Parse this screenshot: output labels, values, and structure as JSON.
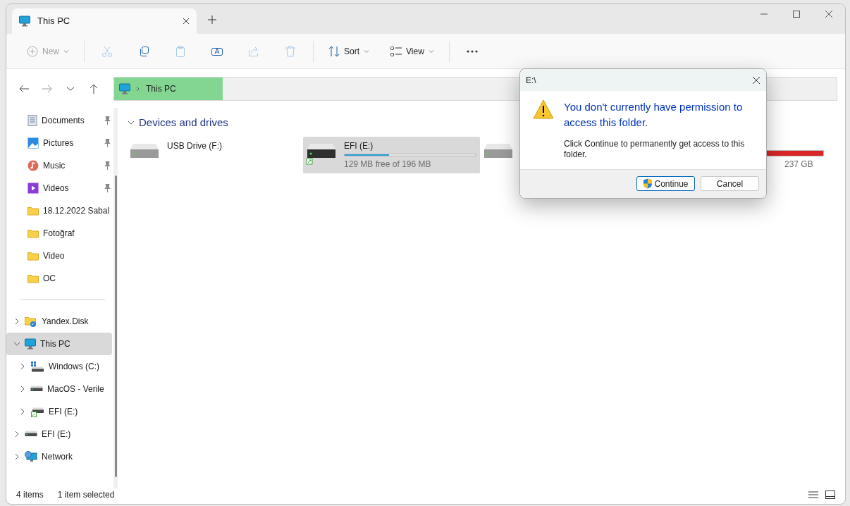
{
  "tabs": [
    {
      "title": "This PC",
      "selected": true
    }
  ],
  "toolbar": [
    {
      "kind": "new",
      "label": "New",
      "disabled": true
    },
    {
      "kind": "cut",
      "disabled": true
    },
    {
      "kind": "copy",
      "disabled": false
    },
    {
      "kind": "paste",
      "disabled": true
    },
    {
      "kind": "rename",
      "disabled": false
    },
    {
      "kind": "share",
      "disabled": true
    },
    {
      "kind": "delete",
      "disabled": true
    },
    {
      "kind": "sort",
      "label": "Sort",
      "disabled": false
    },
    {
      "kind": "view",
      "label": "View",
      "disabled": false
    },
    {
      "kind": "more",
      "disabled": false
    }
  ],
  "address": {
    "path": "This PC"
  },
  "sidebar": {
    "quick_access": [
      {
        "kind": "documents",
        "label": "Documents",
        "pinned": true
      },
      {
        "kind": "pictures",
        "label": "Pictures",
        "pinned": true
      },
      {
        "kind": "music",
        "label": "Music",
        "pinned": true
      },
      {
        "kind": "videos",
        "label": "Videos",
        "pinned": true
      },
      {
        "kind": "folder",
        "label": "18.12.2022 Sabal",
        "pinned": false
      },
      {
        "kind": "folder",
        "label": "Fotoğraf",
        "pinned": false
      },
      {
        "kind": "folder",
        "label": "Video",
        "pinned": false
      },
      {
        "kind": "folder",
        "label": "OC",
        "pinned": false
      }
    ],
    "tree": [
      {
        "kind": "cloud-folder",
        "label": "Yandex.Disk",
        "expanded": false,
        "selected": false
      },
      {
        "kind": "pc",
        "label": "This PC",
        "expanded": true,
        "selected": true,
        "children": [
          {
            "kind": "windows-drive",
            "label": "Windows  (C:)",
            "expanded": false,
            "selected": false
          },
          {
            "kind": "drive",
            "label": "MacOS - Verile",
            "expanded": false,
            "selected": false
          },
          {
            "kind": "shortcut-drive",
            "label": "EFI (E:)",
            "expanded": false,
            "selected": false
          }
        ]
      },
      {
        "kind": "drive",
        "label": "EFI (E:)",
        "expanded": false,
        "selected": false
      },
      {
        "kind": "network",
        "label": "Network",
        "expanded": false,
        "selected": false
      }
    ]
  },
  "section": {
    "title": "Devices and drives",
    "expanded": true
  },
  "drives": [
    {
      "kind": "plain",
      "name": "USB Drive (F:)",
      "selected": false
    },
    {
      "kind": "shortcut",
      "name": "EFI (E:)",
      "level": 0.34,
      "color": "#26a0da",
      "details": "129 MB free of 196 MB",
      "selected": true
    },
    {
      "kind": "hidden",
      "level": 1,
      "color": "#da2626",
      "details": "237 GB",
      "selected": false
    }
  ],
  "status_bar": {
    "count": "4 items",
    "selection": "1 item selected"
  },
  "dialog": {
    "title": "E:\\",
    "heading": "You don't currently have permission to access this folder.",
    "message": "Click Continue to permanently get access to this folder.",
    "buttons": [
      {
        "kind": "elevated",
        "label": "Continue",
        "default": true
      },
      {
        "kind": "plain",
        "label": "Cancel",
        "default": false
      }
    ]
  }
}
